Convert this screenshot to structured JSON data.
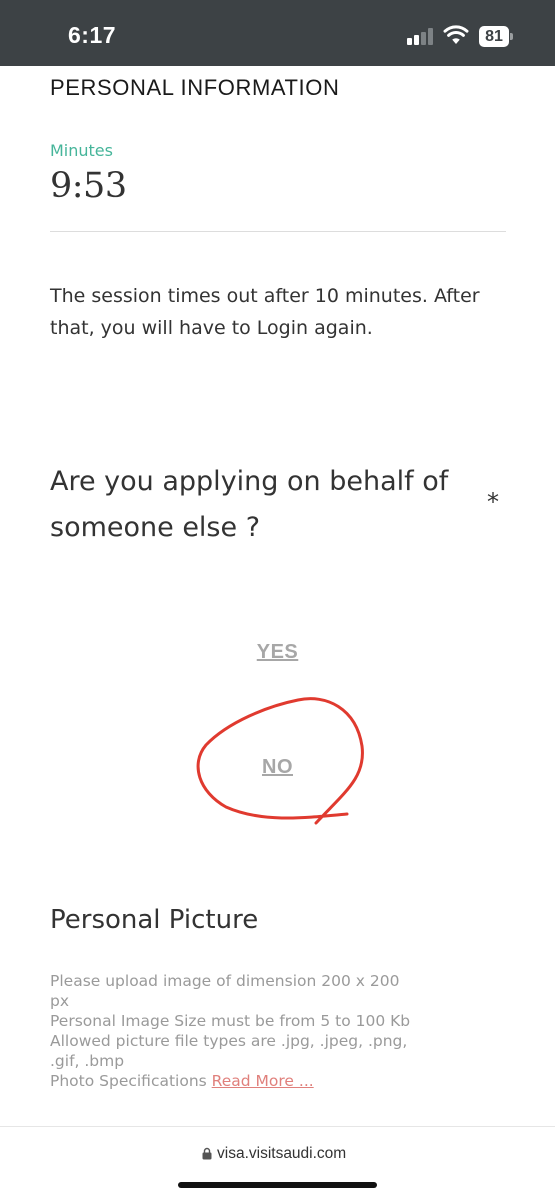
{
  "status_bar": {
    "time": "6:17",
    "battery": "81",
    "icons": [
      "signal-icon",
      "wifi-icon",
      "battery-icon"
    ]
  },
  "section": {
    "heading": "PERSONAL INFORMATION"
  },
  "timer": {
    "label": "Minutes",
    "value": "9:53"
  },
  "session_notice": "The session times out after 10 minutes. After that, you will have to Login again.",
  "question": {
    "text": "Are you applying on behalf of someone else ?",
    "required_marker": "*"
  },
  "options": {
    "yes": "YES",
    "no": "NO"
  },
  "personal_picture": {
    "heading": "Personal Picture",
    "line1": "Please upload image of dimension 200 x 200 px",
    "line2": "Personal Image Size must be from 5 to 100 Kb",
    "line3": "Allowed picture file types are .jpg, .jpeg, .png, .gif, .bmp",
    "line4_prefix": "Photo Specifications ",
    "read_more": "Read More ..."
  },
  "browser": {
    "url": "visa.visitsaudi.com"
  },
  "colors": {
    "status_bar_bg": "#3d4245",
    "accent_green": "#46b59a",
    "link_red": "#e0807c",
    "annotation_red": "#e03a2f",
    "option_gray": "#a7a7a7"
  }
}
